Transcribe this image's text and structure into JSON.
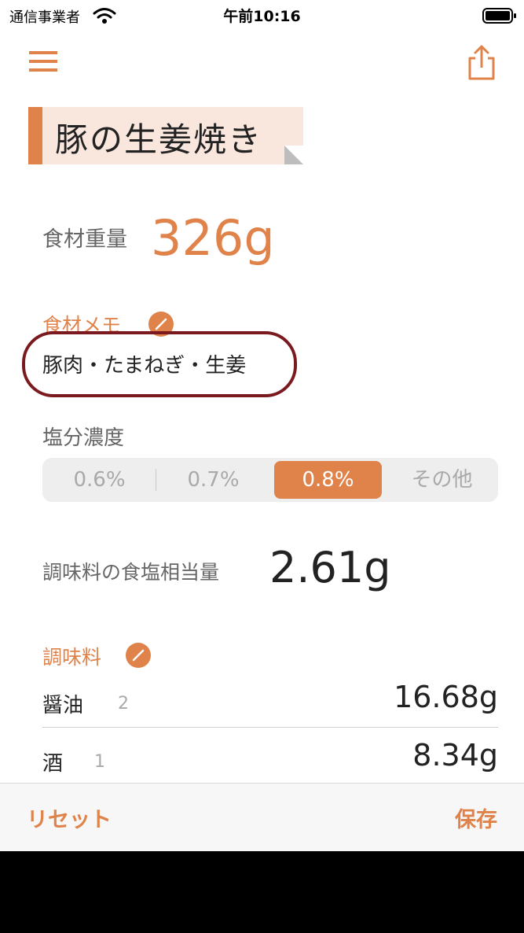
{
  "status_bar": {
    "carrier": "通信事業者",
    "time": "午前10:16"
  },
  "recipe": {
    "title": "豚の生姜焼き"
  },
  "weight": {
    "label": "食材重量",
    "value": "326g"
  },
  "memo": {
    "label": "食材メモ",
    "text": "豚肉・たまねぎ・生姜"
  },
  "salt": {
    "label": "塩分濃度",
    "options": [
      "0.6%",
      "0.7%",
      "0.8%",
      "その他"
    ],
    "selected": "0.8%"
  },
  "salt_equivalent": {
    "label": "調味料の食塩相当量",
    "value": "2.61g"
  },
  "seasonings": {
    "label": "調味料",
    "items": [
      {
        "name": "醤油",
        "qty": "2",
        "value": "16.68g"
      },
      {
        "name": "酒",
        "qty": "1",
        "value": "8.34g"
      }
    ]
  },
  "toolbar": {
    "reset": "リセット",
    "save": "保存"
  },
  "colors": {
    "accent": "#e0834a",
    "title_bg": "#f9e6dd",
    "annotation": "#7a1a1f"
  },
  "icons": [
    "wifi-icon",
    "battery-icon",
    "hamburger-menu-icon",
    "share-icon",
    "pencil-icon"
  ]
}
